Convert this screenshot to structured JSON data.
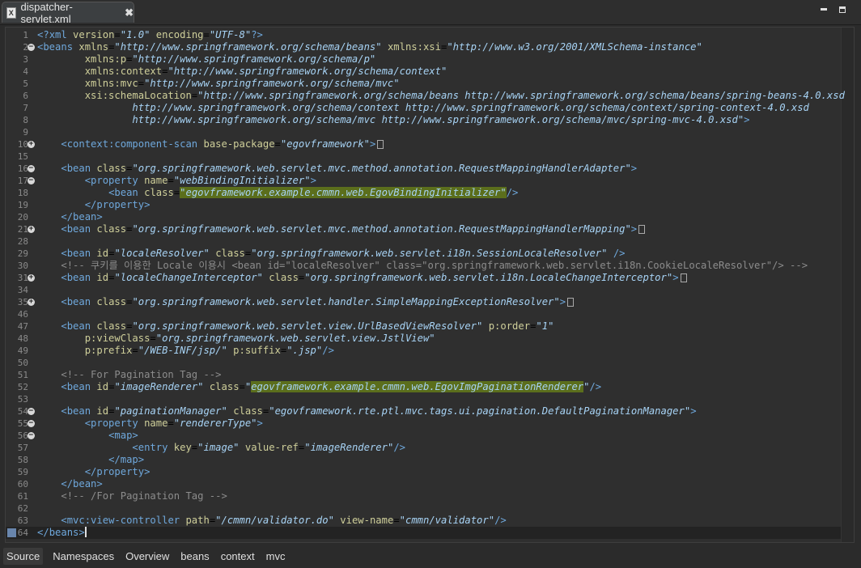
{
  "tab": {
    "title": "dispatcher-servlet.xml",
    "file_icon": "X",
    "close": "✖"
  },
  "bottom_tabs": [
    "Source",
    "Namespaces",
    "Overview",
    "beans",
    "context",
    "mvc"
  ],
  "lines": [
    {
      "n": "1",
      "fold": "",
      "html": "<span class='p'>&lt;?</span><span class='t'>xml</span> <span class='a'>version</span>=<span class='s'>\"1.0\"</span> <span class='a'>encoding</span>=<span class='s'>\"UTF-8\"</span><span class='p'>?&gt;</span>"
    },
    {
      "n": "2",
      "fold": "-",
      "html": "<span class='p'>&lt;</span><span class='t'>beans</span> <span class='a'>xmlns</span>=<span class='s'>\"http://www.springframework.org/schema/beans\"</span> <span class='a'>xmlns:xsi</span>=<span class='s'>\"http://www.w3.org/2001/XMLSchema-instance\"</span>"
    },
    {
      "n": "3",
      "fold": "",
      "html": "        <span class='a'>xmlns:p</span>=<span class='s'>\"http://www.springframework.org/schema/p\"</span>"
    },
    {
      "n": "4",
      "fold": "",
      "html": "        <span class='a'>xmlns:context</span>=<span class='s'>\"http://www.springframework.org/schema/context\"</span>"
    },
    {
      "n": "5",
      "fold": "",
      "html": "        <span class='a'>xmlns:mvc</span>=<span class='s'>\"http://www.springframework.org/schema/mvc\"</span>"
    },
    {
      "n": "6",
      "fold": "",
      "html": "        <span class='a'>xsi:schemaLocation</span>=<span class='s'>\"http://www.springframework.org/schema/beans http://www.springframework.org/schema/beans/spring-beans-4.0.xsd</span>"
    },
    {
      "n": "7",
      "fold": "",
      "html": "                <span class='s'>http://www.springframework.org/schema/context http://www.springframework.org/schema/context/spring-context-4.0.xsd</span>"
    },
    {
      "n": "8",
      "fold": "",
      "html": "                <span class='s'>http://www.springframework.org/schema/mvc http://www.springframework.org/schema/mvc/spring-mvc-4.0.xsd\"</span><span class='p'>&gt;</span>"
    },
    {
      "n": "9",
      "fold": "",
      "html": ""
    },
    {
      "n": "10",
      "fold": "+",
      "html": "    <span class='p'>&lt;</span><span class='t'>context:component-scan</span> <span class='a'>base-package</span>=<span class='s'>\"egovframework\"</span><span class='p'>&gt;</span><span class='box'></span>"
    },
    {
      "n": "15",
      "fold": "",
      "html": ""
    },
    {
      "n": "16",
      "fold": "-",
      "html": "    <span class='p'>&lt;</span><span class='t'>bean</span> <span class='a'>class</span>=<span class='s'>\"org.springframework.web.servlet.mvc.method.annotation.RequestMappingHandlerAdapter\"</span><span class='p'>&gt;</span>"
    },
    {
      "n": "17",
      "fold": "-",
      "html": "        <span class='p'>&lt;</span><span class='t'>property</span> <span class='a'>name</span>=<span class='s'>\"webBindingInitializer\"</span><span class='p'>&gt;</span>"
    },
    {
      "n": "18",
      "fold": "",
      "html": "            <span class='p'>&lt;</span><span class='t'>bean</span> <span class='a'>class</span>=<span class='s hl'>\"egovframework.example.cmmn.web.EgovBindingInitializer\"</span><span class='p'>/&gt;</span>"
    },
    {
      "n": "19",
      "fold": "",
      "html": "        <span class='p'>&lt;/</span><span class='t'>property</span><span class='p'>&gt;</span>"
    },
    {
      "n": "20",
      "fold": "",
      "html": "    <span class='p'>&lt;/</span><span class='t'>bean</span><span class='p'>&gt;</span>"
    },
    {
      "n": "21",
      "fold": "+",
      "html": "    <span class='p'>&lt;</span><span class='t'>bean</span> <span class='a'>class</span>=<span class='s'>\"org.springframework.web.servlet.mvc.method.annotation.RequestMappingHandlerMapping\"</span><span class='p'>&gt;</span><span class='box'></span>"
    },
    {
      "n": "28",
      "fold": "",
      "html": ""
    },
    {
      "n": "29",
      "fold": "",
      "html": "    <span class='p'>&lt;</span><span class='t'>bean</span> <span class='a'>id</span>=<span class='s'>\"localeResolver\"</span> <span class='a'>class</span>=<span class='s'>\"org.springframework.web.servlet.i18n.SessionLocaleResolver\"</span> <span class='p'>/&gt;</span>"
    },
    {
      "n": "30",
      "fold": "",
      "html": "    <span class='c'>&lt;!-- 쿠키를 이용한 Locale 이용시 &lt;bean id=\"localeResolver\" class=\"org.springframework.web.servlet.i18n.CookieLocaleResolver\"/&gt; --&gt;</span>"
    },
    {
      "n": "31",
      "fold": "+",
      "html": "    <span class='p'>&lt;</span><span class='t'>bean</span> <span class='a'>id</span>=<span class='s'>\"localeChangeInterceptor\"</span> <span class='a'>class</span>=<span class='s'>\"org.springframework.web.servlet.i18n.LocaleChangeInterceptor\"</span><span class='p'>&gt;</span><span class='box'></span>"
    },
    {
      "n": "34",
      "fold": "",
      "html": ""
    },
    {
      "n": "35",
      "fold": "+",
      "html": "    <span class='p'>&lt;</span><span class='t'>bean</span> <span class='a'>class</span>=<span class='s'>\"org.springframework.web.servlet.handler.SimpleMappingExceptionResolver\"</span><span class='p'>&gt;</span><span class='box'></span>"
    },
    {
      "n": "46",
      "fold": "",
      "html": ""
    },
    {
      "n": "47",
      "fold": "",
      "html": "    <span class='p'>&lt;</span><span class='t'>bean</span> <span class='a'>class</span>=<span class='s'>\"org.springframework.web.servlet.view.UrlBasedViewResolver\"</span> <span class='a'>p:order</span>=<span class='s'>\"1\"</span>"
    },
    {
      "n": "48",
      "fold": "",
      "html": "        <span class='a'>p:viewClass</span>=<span class='s'>\"org.springframework.web.servlet.view.JstlView\"</span>"
    },
    {
      "n": "49",
      "fold": "",
      "html": "        <span class='a'>p:prefix</span>=<span class='s'>\"/WEB-INF/jsp/\"</span> <span class='a'>p:suffix</span>=<span class='s'>\".jsp\"</span><span class='p'>/&gt;</span>"
    },
    {
      "n": "50",
      "fold": "",
      "html": ""
    },
    {
      "n": "51",
      "fold": "",
      "html": "    <span class='c'>&lt;!-- For Pagination Tag --&gt;</span>"
    },
    {
      "n": "52",
      "fold": "",
      "html": "    <span class='p'>&lt;</span><span class='t'>bean</span> <span class='a'>id</span>=<span class='s'>\"imageRenderer\"</span> <span class='a'>class</span>=<span class='s'>\"<span class='hl'>egovframework.example.cmmn.web.EgovImgPaginationRenderer</span>\"</span><span class='p'>/&gt;</span>"
    },
    {
      "n": "53",
      "fold": "",
      "html": ""
    },
    {
      "n": "54",
      "fold": "-",
      "html": "    <span class='p'>&lt;</span><span class='t'>bean</span> <span class='a'>id</span>=<span class='s'>\"paginationManager\"</span> <span class='a'>class</span>=<span class='s'>\"egovframework.rte.ptl.mvc.tags.ui.pagination.DefaultPaginationManager\"</span><span class='p'>&gt;</span>"
    },
    {
      "n": "55",
      "fold": "-",
      "html": "        <span class='p'>&lt;</span><span class='t'>property</span> <span class='a'>name</span>=<span class='s'>\"rendererType\"</span><span class='p'>&gt;</span>"
    },
    {
      "n": "56",
      "fold": "-",
      "html": "            <span class='p'>&lt;</span><span class='t'>map</span><span class='p'>&gt;</span>"
    },
    {
      "n": "57",
      "fold": "",
      "html": "                <span class='p'>&lt;</span><span class='t'>entry</span> <span class='a'>key</span>=<span class='s'>\"image\"</span> <span class='a'>value-ref</span>=<span class='s'>\"imageRenderer\"</span><span class='p'>/&gt;</span>"
    },
    {
      "n": "58",
      "fold": "",
      "html": "            <span class='p'>&lt;/</span><span class='t'>map</span><span class='p'>&gt;</span>"
    },
    {
      "n": "59",
      "fold": "",
      "html": "        <span class='p'>&lt;/</span><span class='t'>property</span><span class='p'>&gt;</span>"
    },
    {
      "n": "60",
      "fold": "",
      "html": "    <span class='p'>&lt;/</span><span class='t'>bean</span><span class='p'>&gt;</span>"
    },
    {
      "n": "61",
      "fold": "",
      "html": "    <span class='c'>&lt;!-- /For Pagination Tag --&gt;</span>"
    },
    {
      "n": "62",
      "fold": "",
      "html": ""
    },
    {
      "n": "63",
      "fold": "",
      "html": "    <span class='p'>&lt;</span><span class='t'>mvc:view-controller</span> <span class='a'>path</span>=<span class='s'>\"/cmmn/validator.do\"</span> <span class='a'>view-name</span>=<span class='s'>\"cmmn/validator\"</span><span class='p'>/&gt;</span>"
    },
    {
      "n": "64",
      "fold": "",
      "html": "<span class='p'>&lt;/</span><span class='t'>beans</span><span class='p'>&gt;</span>",
      "current": true
    }
  ]
}
